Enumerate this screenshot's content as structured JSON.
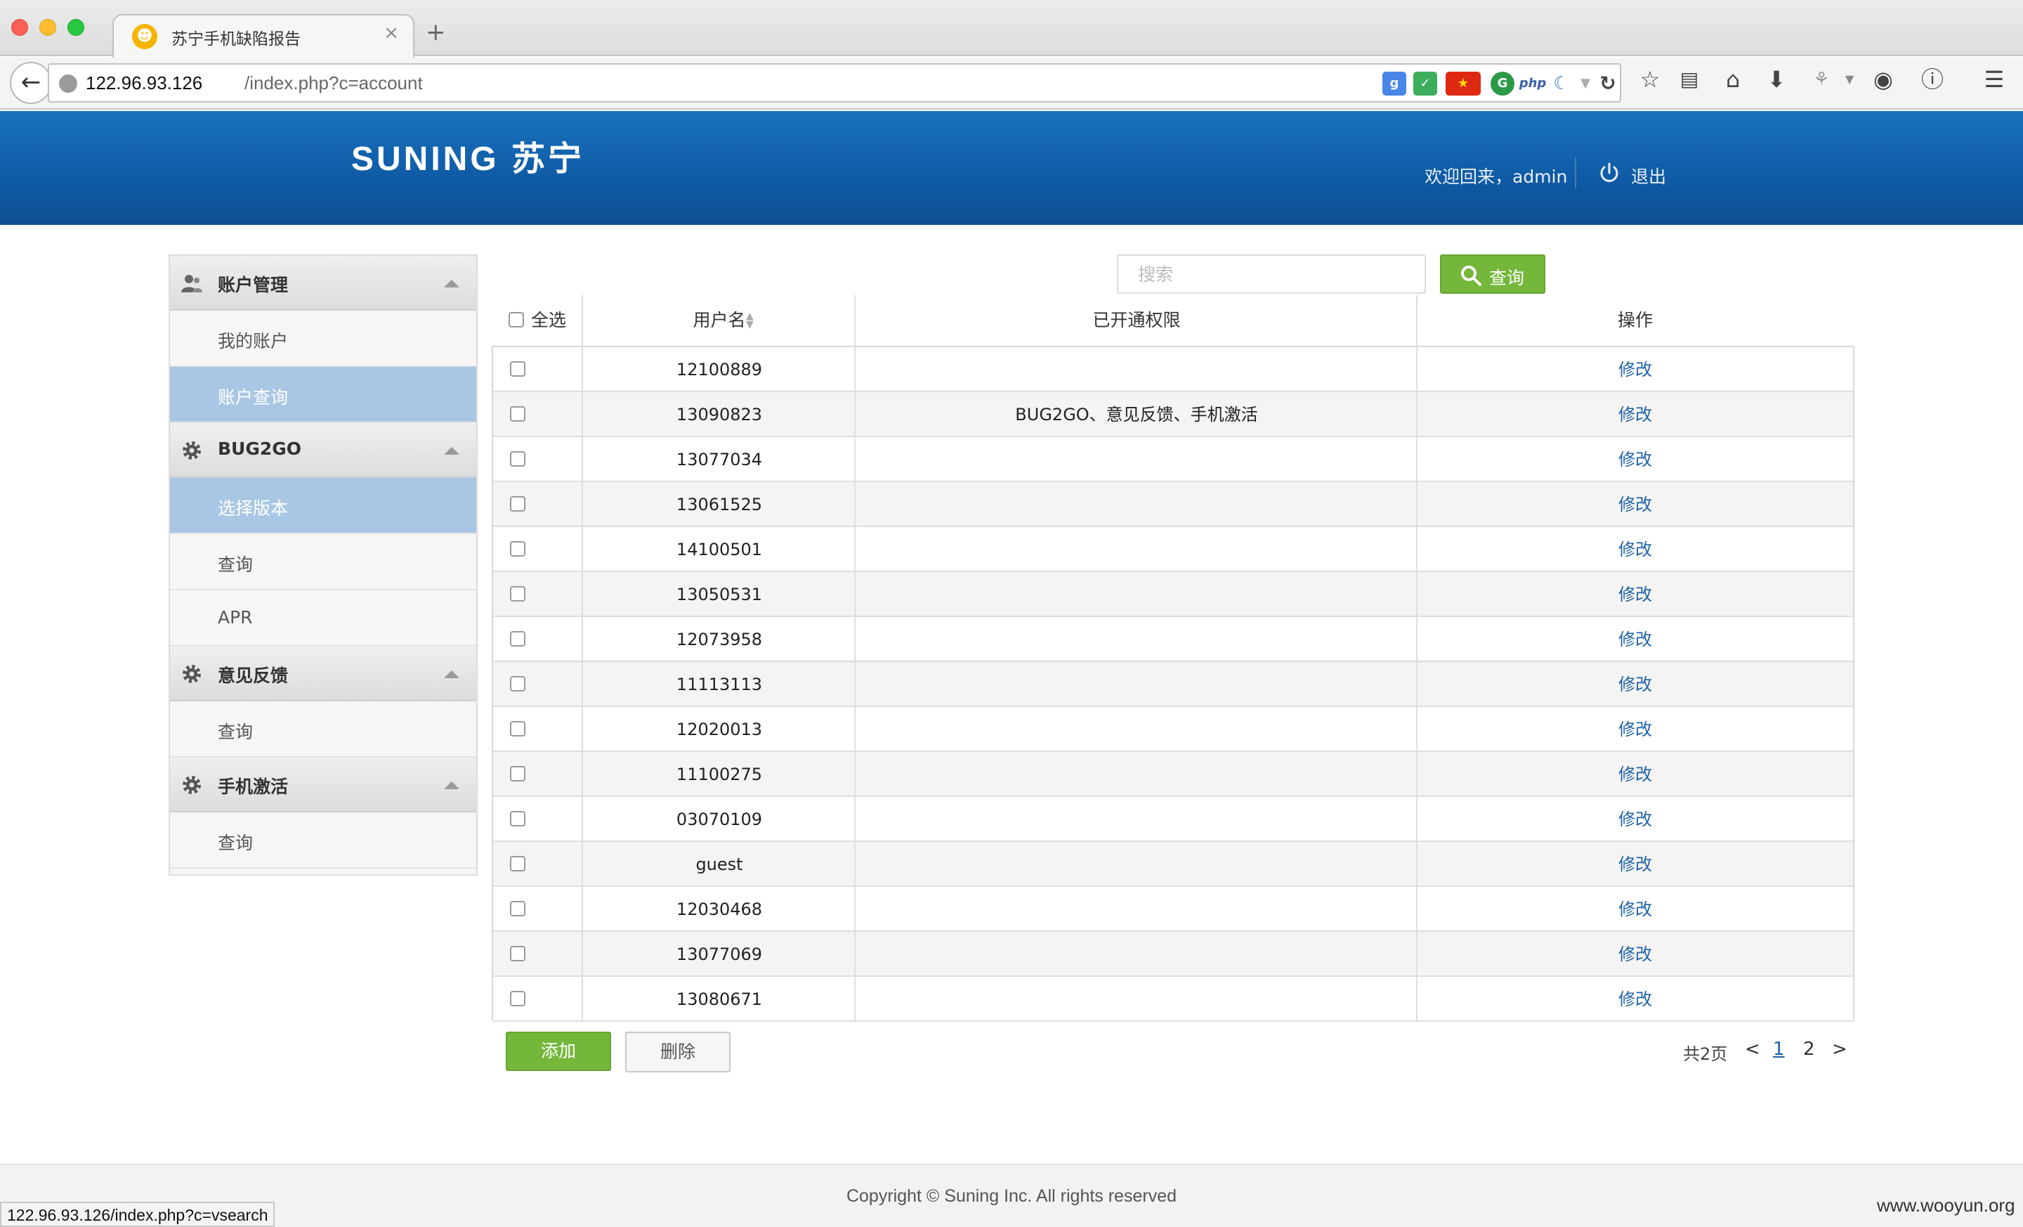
{
  "browser": {
    "tab_title": "苏宁手机缺陷报告",
    "tab_close": "×",
    "new_tab": "+",
    "url_host": "122.96.93.126",
    "url_path": "/index.php?c=account",
    "status_url": "122.96.93.126/index.php?c=vsearch"
  },
  "header": {
    "logo": "SUNING 苏宁",
    "welcome": "欢迎回来，admin",
    "logout": "退出"
  },
  "sidebar": {
    "groups": [
      {
        "label": "账户管理",
        "icon": "users-icon",
        "items": [
          {
            "label": "我的账户",
            "active": false
          },
          {
            "label": "账户查询",
            "active": true
          }
        ]
      },
      {
        "label": "BUG2GO",
        "icon": "gear-icon",
        "items": [
          {
            "label": "选择版本",
            "active": true
          },
          {
            "label": "查询",
            "active": false
          },
          {
            "label": "APR",
            "active": false
          }
        ]
      },
      {
        "label": "意见反馈",
        "icon": "gear-icon",
        "items": [
          {
            "label": "查询",
            "active": false
          }
        ]
      },
      {
        "label": "手机激活",
        "icon": "gear-icon",
        "items": [
          {
            "label": "查询",
            "active": false
          }
        ]
      }
    ]
  },
  "search": {
    "placeholder": "搜索",
    "button": "查询"
  },
  "table": {
    "headers": {
      "select_all": "全选",
      "username": "用户名",
      "permissions": "已开通权限",
      "actions": "操作"
    },
    "rows": [
      {
        "username": "12100889",
        "permissions": "",
        "action": "修改"
      },
      {
        "username": "13090823",
        "permissions": "BUG2GO、意见反馈、手机激活",
        "action": "修改"
      },
      {
        "username": "13077034",
        "permissions": "",
        "action": "修改"
      },
      {
        "username": "13061525",
        "permissions": "",
        "action": "修改"
      },
      {
        "username": "14100501",
        "permissions": "",
        "action": "修改"
      },
      {
        "username": "13050531",
        "permissions": "",
        "action": "修改"
      },
      {
        "username": "12073958",
        "permissions": "",
        "action": "修改"
      },
      {
        "username": "11113113",
        "permissions": "",
        "action": "修改"
      },
      {
        "username": "12020013",
        "permissions": "",
        "action": "修改"
      },
      {
        "username": "11100275",
        "permissions": "",
        "action": "修改"
      },
      {
        "username": "03070109",
        "permissions": "",
        "action": "修改"
      },
      {
        "username": "guest",
        "permissions": "",
        "action": "修改"
      },
      {
        "username": "12030468",
        "permissions": "",
        "action": "修改"
      },
      {
        "username": "13077069",
        "permissions": "",
        "action": "修改"
      },
      {
        "username": "13080671",
        "permissions": "",
        "action": "修改"
      }
    ]
  },
  "actions": {
    "add": "添加",
    "delete": "删除"
  },
  "pager": {
    "total": "共2页",
    "prev": "<",
    "pages": [
      "1",
      "2"
    ],
    "next": ">"
  },
  "footer": {
    "copyright": "Copyright © Suning Inc. All rights reserved",
    "watermark": "www.wooyun.org"
  },
  "colors": {
    "header_blue": "#0f5aa4",
    "accent_green": "#74b73b",
    "active_item": "#a9c7e4",
    "link_blue": "#1f62a6"
  }
}
